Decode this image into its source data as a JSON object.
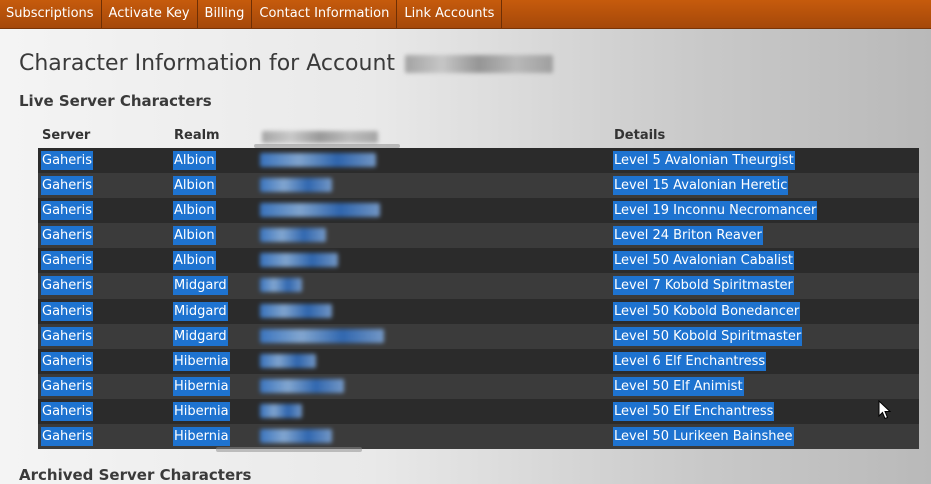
{
  "nav": {
    "items": [
      {
        "label": "Subscriptions"
      },
      {
        "label": "Activate Key"
      },
      {
        "label": "Billing"
      },
      {
        "label": "Contact Information"
      },
      {
        "label": "Link Accounts"
      }
    ]
  },
  "page": {
    "title": "Character Information for Account"
  },
  "live": {
    "heading": "Live Server Characters",
    "columns": {
      "server": "Server",
      "realm": "Realm",
      "details": "Details"
    },
    "rows": [
      {
        "server": "Gaheris",
        "realm": "Albion",
        "details": "Level 5 Avalonian Theurgist"
      },
      {
        "server": "Gaheris",
        "realm": "Albion",
        "details": "Level 15 Avalonian Heretic"
      },
      {
        "server": "Gaheris",
        "realm": "Albion",
        "details": "Level 19 Inconnu Necromancer"
      },
      {
        "server": "Gaheris",
        "realm": "Albion",
        "details": "Level 24 Briton Reaver"
      },
      {
        "server": "Gaheris",
        "realm": "Albion",
        "details": "Level 50 Avalonian Cabalist"
      },
      {
        "server": "Gaheris",
        "realm": "Midgard",
        "details": "Level 7 Kobold Spiritmaster"
      },
      {
        "server": "Gaheris",
        "realm": "Midgard",
        "details": "Level 50 Kobold Bonedancer"
      },
      {
        "server": "Gaheris",
        "realm": "Midgard",
        "details": "Level 50 Kobold Spiritmaster"
      },
      {
        "server": "Gaheris",
        "realm": "Hibernia",
        "details": "Level 6 Elf Enchantress"
      },
      {
        "server": "Gaheris",
        "realm": "Hibernia",
        "details": "Level 50 Elf Animist"
      },
      {
        "server": "Gaheris",
        "realm": "Hibernia",
        "details": "Level 50 Elf Enchantress"
      },
      {
        "server": "Gaheris",
        "realm": "Hibernia",
        "details": "Level 50 Lurikeen Bainshee"
      }
    ]
  },
  "archived": {
    "heading": "Archived Server Characters"
  },
  "colors": {
    "nav_bg": "#b4500b",
    "selection": "#1e73d0",
    "row_dark": "#2b2b2b",
    "row_light": "#3b3b3b"
  }
}
